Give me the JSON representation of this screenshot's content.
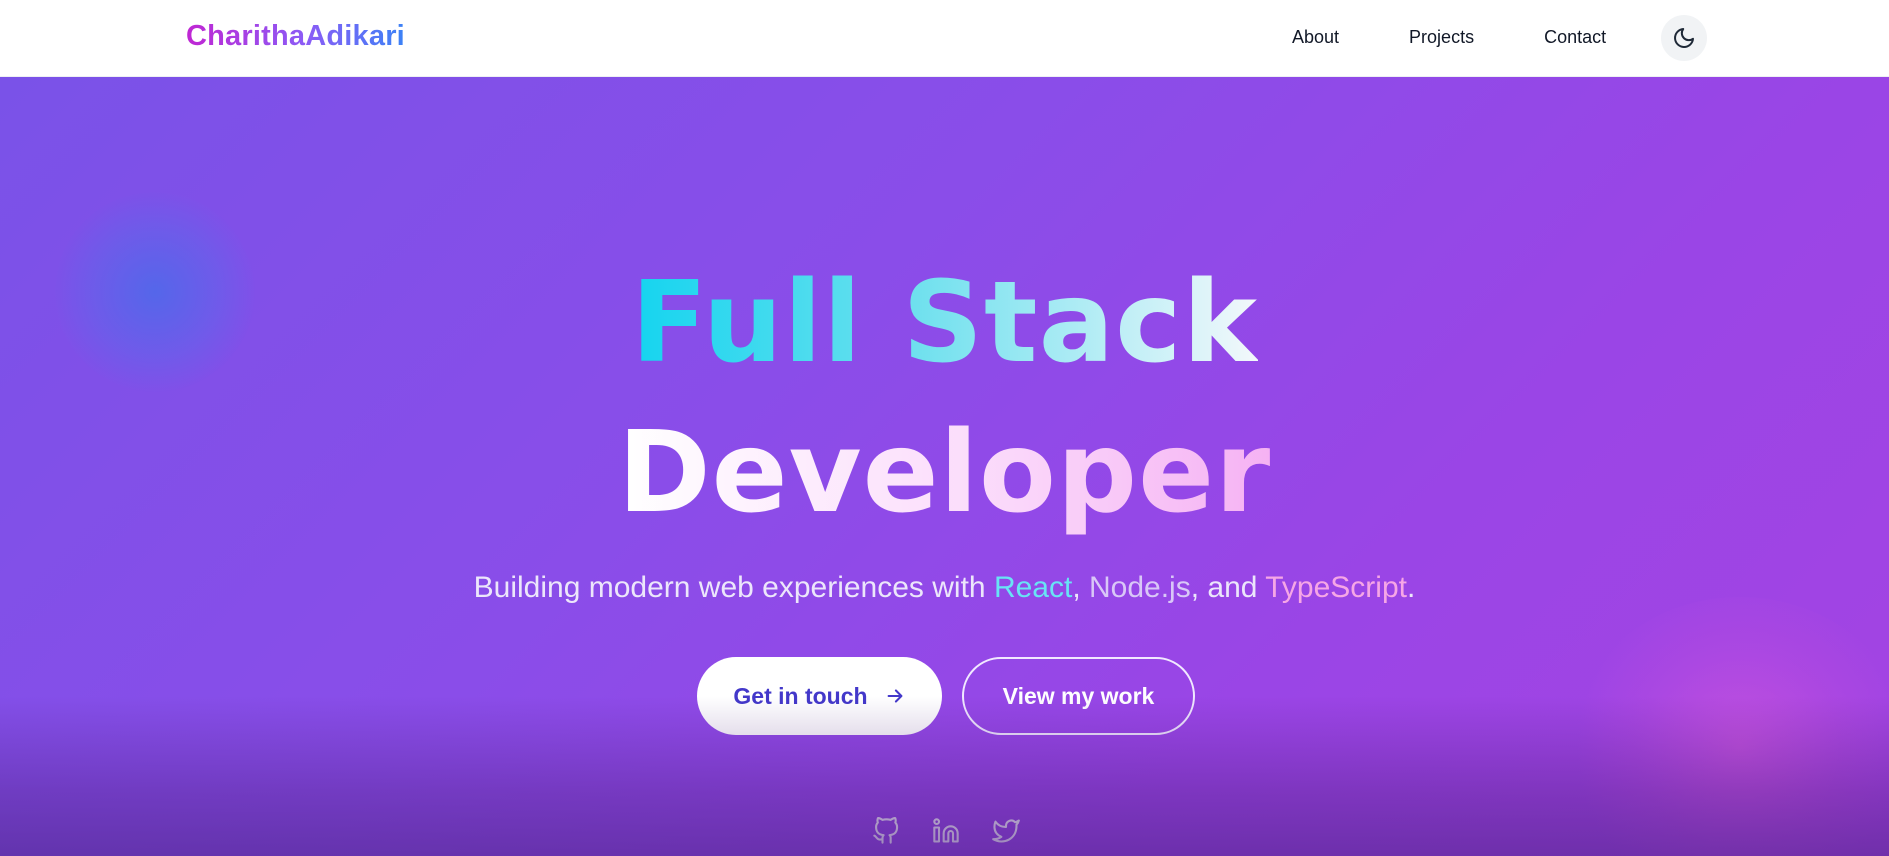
{
  "header": {
    "logo": "CharithaAdikari",
    "nav": [
      "About",
      "Projects",
      "Contact"
    ],
    "theme_toggle_icon": "moon-icon"
  },
  "hero": {
    "title_line1": "Full Stack",
    "title_line2": "Developer",
    "subtitle": {
      "prefix": "Building modern web experiences with ",
      "tech1": "React",
      "sep1": ", ",
      "tech2": "Node.js",
      "sep2": ", and ",
      "tech3": "TypeScript",
      "suffix": "."
    },
    "primary_button": "Get in touch",
    "primary_button_icon": "arrow-right-icon",
    "secondary_button": "View my work",
    "social_icons": [
      "github-icon",
      "linkedin-icon",
      "twitter-icon"
    ]
  },
  "colors": {
    "hero_gradient_start": "#7a52e8",
    "hero_gradient_end": "#a444e2",
    "primary_button_text": "#4338ca",
    "react_color": "#68e4f5",
    "typescript_color": "#f6a6e6"
  }
}
